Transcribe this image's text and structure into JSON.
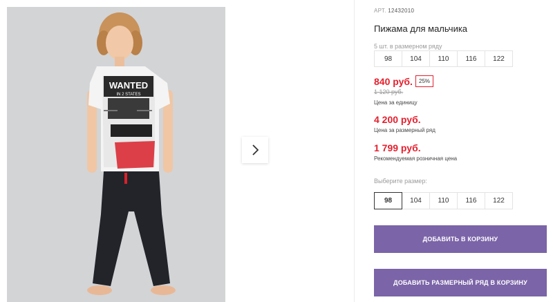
{
  "product": {
    "article_label": "АРТ.",
    "article": "12432010",
    "title": "Пижама для мальчика",
    "photo_shirt_text": "WANTED",
    "photo_shirt_sub": "IN 2 STATES"
  },
  "size_range": {
    "label": "5 шт. в размерном ряду",
    "sizes": [
      "98",
      "104",
      "110",
      "116",
      "122"
    ]
  },
  "prices": {
    "unit_price": "840 руб.",
    "discount": "25%",
    "old_price": "1 120 руб.",
    "unit_caption": "Цена за единицу",
    "range_price": "4 200 руб.",
    "range_caption": "Цена за размерный ряд",
    "rrp_price": "1 799 руб.",
    "rrp_caption": "Рекомендуемая розничная цена"
  },
  "size_picker": {
    "label": "Выберите размер:",
    "sizes": [
      "98",
      "104",
      "110",
      "116",
      "122"
    ],
    "selected": "98"
  },
  "actions": {
    "add_to_cart": "ДОБАВИТЬ В КОРЗИНУ",
    "add_range_to_cart": "ДОБАВИТЬ РАЗМЕРНЫЙ РЯД В КОРЗИНУ"
  },
  "icons": {
    "next": "chevron-right-icon"
  },
  "colors": {
    "accent": "#7b64a8",
    "price": "#e4202e"
  }
}
